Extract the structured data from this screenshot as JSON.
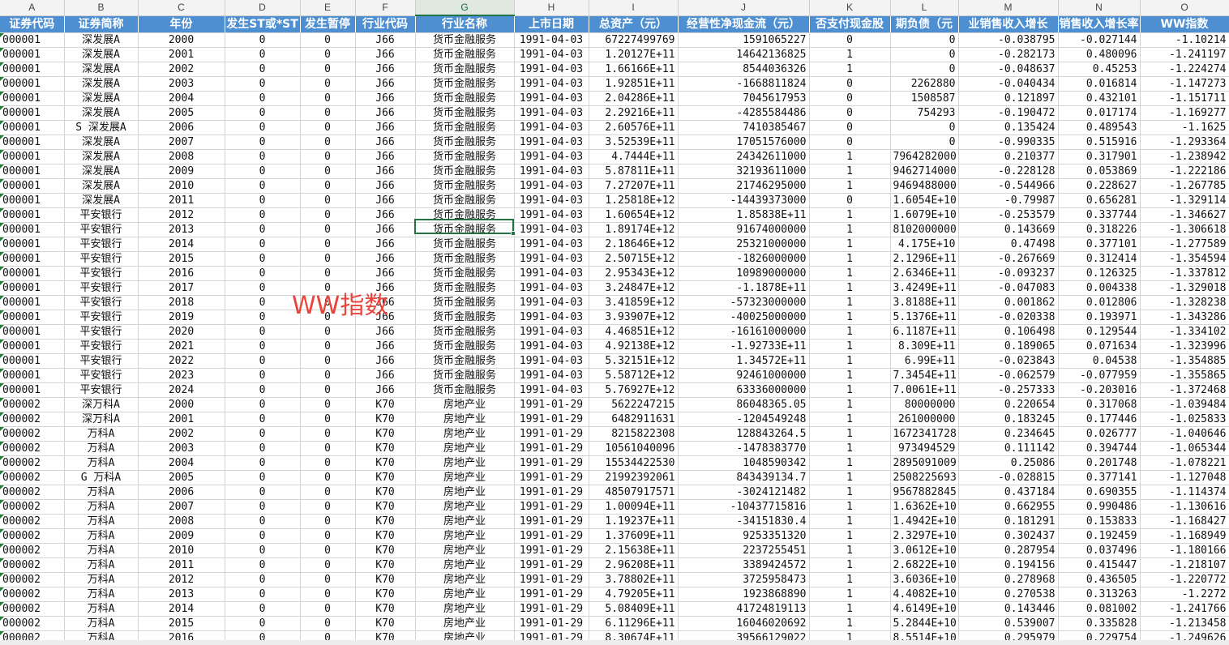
{
  "sheet": {
    "columns": [
      "A",
      "B",
      "C",
      "D",
      "E",
      "F",
      "G",
      "H",
      "I",
      "J",
      "K",
      "L",
      "M",
      "N",
      "O"
    ],
    "selected_column": "G",
    "headers": [
      "证券代码",
      "证券简称",
      "年份",
      "发生ST或*ST",
      "发生暂停",
      "行业代码",
      "行业名称",
      "上市日期",
      "总资产（元）",
      "经营性净现金流（元）",
      "否支付现金股",
      "期负债（元",
      "业销售收入增长",
      "销售收入增长率",
      "WW指数"
    ],
    "rows": [
      [
        "000001",
        "深发展A",
        "2000",
        "0",
        "0",
        "J66",
        "货币金融服务",
        "1991-04-03",
        "67227499769",
        "1591065227",
        "0",
        "0",
        "-0.038795",
        "-0.027144",
        "-1.10214"
      ],
      [
        "000001",
        "深发展A",
        "2001",
        "0",
        "0",
        "J66",
        "货币金融服务",
        "1991-04-03",
        "1.20127E+11",
        "14642136825",
        "1",
        "0",
        "-0.282173",
        "0.480096",
        "-1.241197"
      ],
      [
        "000001",
        "深发展A",
        "2002",
        "0",
        "0",
        "J66",
        "货币金融服务",
        "1991-04-03",
        "1.66166E+11",
        "8544036326",
        "1",
        "0",
        "-0.048637",
        "0.45253",
        "-1.224274"
      ],
      [
        "000001",
        "深发展A",
        "2003",
        "0",
        "0",
        "J66",
        "货币金融服务",
        "1991-04-03",
        "1.92851E+11",
        "-1668811824",
        "0",
        "2262880",
        "-0.040434",
        "0.016814",
        "-1.147273"
      ],
      [
        "000001",
        "深发展A",
        "2004",
        "0",
        "0",
        "J66",
        "货币金融服务",
        "1991-04-03",
        "2.04286E+11",
        "7045617953",
        "0",
        "1508587",
        "0.121897",
        "0.432101",
        "-1.151711"
      ],
      [
        "000001",
        "深发展A",
        "2005",
        "0",
        "0",
        "J66",
        "货币金融服务",
        "1991-04-03",
        "2.29216E+11",
        "-4285584486",
        "0",
        "754293",
        "-0.190472",
        "0.017174",
        "-1.169277"
      ],
      [
        "000001",
        "S 深发展A",
        "2006",
        "0",
        "0",
        "J66",
        "货币金融服务",
        "1991-04-03",
        "2.60576E+11",
        "7410385467",
        "0",
        "0",
        "0.135424",
        "0.489543",
        "-1.1625"
      ],
      [
        "000001",
        "深发展A",
        "2007",
        "0",
        "0",
        "J66",
        "货币金融服务",
        "1991-04-03",
        "3.52539E+11",
        "17051576000",
        "0",
        "0",
        "-0.990335",
        "0.515916",
        "-1.293364"
      ],
      [
        "000001",
        "深发展A",
        "2008",
        "0",
        "0",
        "J66",
        "货币金融服务",
        "1991-04-03",
        "4.7444E+11",
        "24342611000",
        "1",
        "7964282000",
        "0.210377",
        "0.317901",
        "-1.238942"
      ],
      [
        "000001",
        "深发展A",
        "2009",
        "0",
        "0",
        "J66",
        "货币金融服务",
        "1991-04-03",
        "5.87811E+11",
        "32193611000",
        "1",
        "9462714000",
        "-0.228128",
        "0.053869",
        "-1.222186"
      ],
      [
        "000001",
        "深发展A",
        "2010",
        "0",
        "0",
        "J66",
        "货币金融服务",
        "1991-04-03",
        "7.27207E+11",
        "21746295000",
        "1",
        "9469488000",
        "-0.544966",
        "0.228627",
        "-1.267785"
      ],
      [
        "000001",
        "深发展A",
        "2011",
        "0",
        "0",
        "J66",
        "货币金融服务",
        "1991-04-03",
        "1.25818E+12",
        "-14439373000",
        "0",
        "1.6054E+10",
        "-0.79987",
        "0.656281",
        "-1.329114"
      ],
      [
        "000001",
        "平安银行",
        "2012",
        "0",
        "0",
        "J66",
        "货币金融服务",
        "1991-04-03",
        "1.60654E+12",
        "1.85838E+11",
        "1",
        "1.6079E+10",
        "-0.253579",
        "0.337744",
        "-1.346627"
      ],
      [
        "000001",
        "平安银行",
        "2013",
        "0",
        "0",
        "J66",
        "货币金融服务",
        "1991-04-03",
        "1.89174E+12",
        "91674000000",
        "1",
        "8102000000",
        "0.143669",
        "0.318226",
        "-1.306618"
      ],
      [
        "000001",
        "平安银行",
        "2014",
        "0",
        "0",
        "J66",
        "货币金融服务",
        "1991-04-03",
        "2.18646E+12",
        "25321000000",
        "1",
        "4.175E+10",
        "0.47498",
        "0.377101",
        "-1.277589"
      ],
      [
        "000001",
        "平安银行",
        "2015",
        "0",
        "0",
        "J66",
        "货币金融服务",
        "1991-04-03",
        "2.50715E+12",
        "-1826000000",
        "1",
        "2.1296E+11",
        "-0.267669",
        "0.312414",
        "-1.354594"
      ],
      [
        "000001",
        "平安银行",
        "2016",
        "0",
        "0",
        "J66",
        "货币金融服务",
        "1991-04-03",
        "2.95343E+12",
        "10989000000",
        "1",
        "2.6346E+11",
        "-0.093237",
        "0.126325",
        "-1.337812"
      ],
      [
        "000001",
        "平安银行",
        "2017",
        "0",
        "0",
        "J66",
        "货币金融服务",
        "1991-04-03",
        "3.24847E+12",
        "-1.1878E+11",
        "1",
        "3.4249E+11",
        "-0.047083",
        "0.004338",
        "-1.329018"
      ],
      [
        "000001",
        "平安银行",
        "2018",
        "0",
        "0",
        "J66",
        "货币金融服务",
        "1991-04-03",
        "3.41859E+12",
        "-57323000000",
        "1",
        "3.8188E+11",
        "0.001862",
        "0.012806",
        "-1.328238"
      ],
      [
        "000001",
        "平安银行",
        "2019",
        "0",
        "0",
        "J66",
        "货币金融服务",
        "1991-04-03",
        "3.93907E+12",
        "-40025000000",
        "1",
        "5.1376E+11",
        "-0.020338",
        "0.193971",
        "-1.343286"
      ],
      [
        "000001",
        "平安银行",
        "2020",
        "0",
        "0",
        "J66",
        "货币金融服务",
        "1991-04-03",
        "4.46851E+12",
        "-16161000000",
        "1",
        "6.1187E+11",
        "0.106498",
        "0.129544",
        "-1.334102"
      ],
      [
        "000001",
        "平安银行",
        "2021",
        "0",
        "0",
        "J66",
        "货币金融服务",
        "1991-04-03",
        "4.92138E+12",
        "-1.92733E+11",
        "1",
        "8.309E+11",
        "0.189065",
        "0.071634",
        "-1.323996"
      ],
      [
        "000001",
        "平安银行",
        "2022",
        "0",
        "0",
        "J66",
        "货币金融服务",
        "1991-04-03",
        "5.32151E+12",
        "1.34572E+11",
        "1",
        "6.99E+11",
        "-0.023843",
        "0.04538",
        "-1.354885"
      ],
      [
        "000001",
        "平安银行",
        "2023",
        "0",
        "0",
        "J66",
        "货币金融服务",
        "1991-04-03",
        "5.58712E+12",
        "92461000000",
        "1",
        "7.3454E+11",
        "-0.062579",
        "-0.077959",
        "-1.355865"
      ],
      [
        "000001",
        "平安银行",
        "2024",
        "0",
        "0",
        "J66",
        "货币金融服务",
        "1991-04-03",
        "5.76927E+12",
        "63336000000",
        "1",
        "7.0061E+11",
        "-0.257333",
        "-0.203016",
        "-1.372468"
      ],
      [
        "000002",
        "深万科A",
        "2000",
        "0",
        "0",
        "K70",
        "房地产业",
        "1991-01-29",
        "5622247215",
        "86048365.05",
        "1",
        "80000000",
        "0.220654",
        "0.317068",
        "-1.039484"
      ],
      [
        "000002",
        "深万科A",
        "2001",
        "0",
        "0",
        "K70",
        "房地产业",
        "1991-01-29",
        "6482911631",
        "-1204549248",
        "1",
        "261000000",
        "0.183245",
        "0.177446",
        "-1.025833"
      ],
      [
        "000002",
        "万科A",
        "2002",
        "0",
        "0",
        "K70",
        "房地产业",
        "1991-01-29",
        "8215822308",
        "128843264.5",
        "1",
        "1672341728",
        "0.234645",
        "0.026777",
        "-1.040646"
      ],
      [
        "000002",
        "万科A",
        "2003",
        "0",
        "0",
        "K70",
        "房地产业",
        "1991-01-29",
        "10561040096",
        "-1478383770",
        "1",
        "973494529",
        "0.111142",
        "0.394744",
        "-1.065344"
      ],
      [
        "000002",
        "万科A",
        "2004",
        "0",
        "0",
        "K70",
        "房地产业",
        "1991-01-29",
        "15534422530",
        "1048590342",
        "1",
        "2895091009",
        "0.25086",
        "0.201748",
        "-1.078221"
      ],
      [
        "000002",
        "G 万科A",
        "2005",
        "0",
        "0",
        "K70",
        "房地产业",
        "1991-01-29",
        "21992392061",
        "843439134.7",
        "1",
        "2508225693",
        "-0.028815",
        "0.377141",
        "-1.127048"
      ],
      [
        "000002",
        "万科A",
        "2006",
        "0",
        "0",
        "K70",
        "房地产业",
        "1991-01-29",
        "48507917571",
        "-3024121482",
        "1",
        "9567882845",
        "0.437184",
        "0.690355",
        "-1.114374"
      ],
      [
        "000002",
        "万科A",
        "2007",
        "0",
        "0",
        "K70",
        "房地产业",
        "1991-01-29",
        "1.00094E+11",
        "-10437715816",
        "1",
        "1.6362E+10",
        "0.662955",
        "0.990486",
        "-1.130616"
      ],
      [
        "000002",
        "万科A",
        "2008",
        "0",
        "0",
        "K70",
        "房地产业",
        "1991-01-29",
        "1.19237E+11",
        "-34151830.4",
        "1",
        "1.4942E+10",
        "0.181291",
        "0.153833",
        "-1.168427"
      ],
      [
        "000002",
        "万科A",
        "2009",
        "0",
        "0",
        "K70",
        "房地产业",
        "1991-01-29",
        "1.37609E+11",
        "9253351320",
        "1",
        "2.3297E+10",
        "0.302437",
        "0.192459",
        "-1.168949"
      ],
      [
        "000002",
        "万科A",
        "2010",
        "0",
        "0",
        "K70",
        "房地产业",
        "1991-01-29",
        "2.15638E+11",
        "2237255451",
        "1",
        "3.0612E+10",
        "0.287954",
        "0.037496",
        "-1.180166"
      ],
      [
        "000002",
        "万科A",
        "2011",
        "0",
        "0",
        "K70",
        "房地产业",
        "1991-01-29",
        "2.96208E+11",
        "3389424572",
        "1",
        "2.6822E+10",
        "0.194156",
        "0.415447",
        "-1.218107"
      ],
      [
        "000002",
        "万科A",
        "2012",
        "0",
        "0",
        "K70",
        "房地产业",
        "1991-01-29",
        "3.78802E+11",
        "3725958473",
        "1",
        "3.6036E+10",
        "0.278968",
        "0.436505",
        "-1.220772"
      ],
      [
        "000002",
        "万科A",
        "2013",
        "0",
        "0",
        "K70",
        "房地产业",
        "1991-01-29",
        "4.79205E+11",
        "1923868890",
        "1",
        "4.4082E+10",
        "0.270538",
        "0.313263",
        "-1.2272"
      ],
      [
        "000002",
        "万科A",
        "2014",
        "0",
        "0",
        "K70",
        "房地产业",
        "1991-01-29",
        "5.08409E+11",
        "41724819113",
        "1",
        "4.6149E+10",
        "0.143446",
        "0.081002",
        "-1.241766"
      ],
      [
        "000002",
        "万科A",
        "2015",
        "0",
        "0",
        "K70",
        "房地产业",
        "1991-01-29",
        "6.11296E+11",
        "16046020692",
        "1",
        "5.2844E+10",
        "0.539007",
        "0.335828",
        "-1.213458"
      ],
      [
        "000002",
        "万科A",
        "2016",
        "0",
        "0",
        "K70",
        "房地产业",
        "1991-01-29",
        "8.30674E+11",
        "39566129022",
        "1",
        "8.5514E+10",
        "0.295979",
        "0.229754",
        "-1.249626"
      ]
    ]
  },
  "watermark": "WW指数",
  "colors": {
    "header_bg": "#4e8fd2",
    "selection": "#217346",
    "watermark": "#e8453c"
  }
}
